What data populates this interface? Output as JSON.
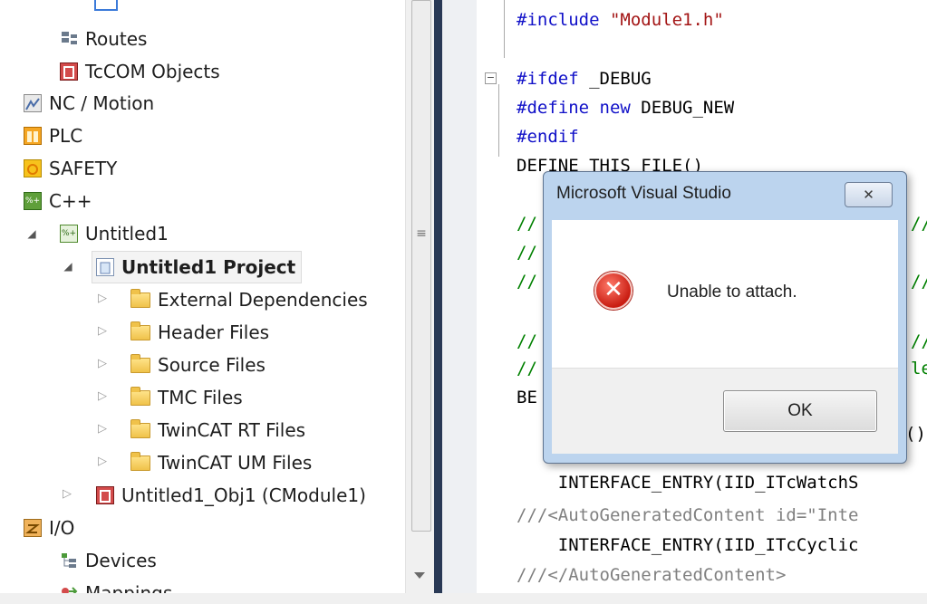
{
  "solution_tree": {
    "items": [
      {
        "label": "Routes"
      },
      {
        "label": "TcCOM Objects"
      },
      {
        "label": "NC / Motion"
      },
      {
        "label": "PLC"
      },
      {
        "label": "SAFETY"
      },
      {
        "label": "C++"
      },
      {
        "label": "Untitled1"
      },
      {
        "label": "Untitled1 Project"
      },
      {
        "label": "External Dependencies"
      },
      {
        "label": "Header Files"
      },
      {
        "label": "Source Files"
      },
      {
        "label": "TMC Files"
      },
      {
        "label": "TwinCAT RT Files"
      },
      {
        "label": "TwinCAT UM Files"
      },
      {
        "label": "Untitled1_Obj1 (CModule1)"
      },
      {
        "label": "I/O"
      },
      {
        "label": "Devices"
      },
      {
        "label": "Mappings"
      }
    ]
  },
  "editor": {
    "lines": [
      {
        "a": "#include ",
        "b": "\"Module1.h\""
      },
      {
        "a": "#ifdef",
        "b": " _DEBUG"
      },
      {
        "a": "#define new",
        "b": " DEBUG_NEW"
      },
      {
        "a": "#endif"
      },
      {
        "a": "DEFINE_THIS_FILE()"
      },
      {
        "a": "//"
      },
      {
        "a": "//"
      },
      {
        "a": "//"
      },
      {
        "a": "//"
      },
      {
        "a": "//"
      },
      {
        "a": "BE"
      },
      {
        "a": "    INTERFACE_ENTRY(IID_ITcWatchS"
      },
      {
        "a": "///",
        "b": "<AutoGeneratedContent id=\"Inte"
      },
      {
        "a": "    INTERFACE_ENTRY(IID_ITcCyclic"
      },
      {
        "a": "///",
        "b": "</AutoGeneratedContent>"
      }
    ],
    "right_edge_fragments": [
      "//",
      "//",
      "//",
      "le",
      "()"
    ]
  },
  "dialog": {
    "title": "Microsoft Visual Studio",
    "close_glyph": "✕",
    "message": "Unable to attach.",
    "ok_label": "OK",
    "icon": "error-icon"
  }
}
